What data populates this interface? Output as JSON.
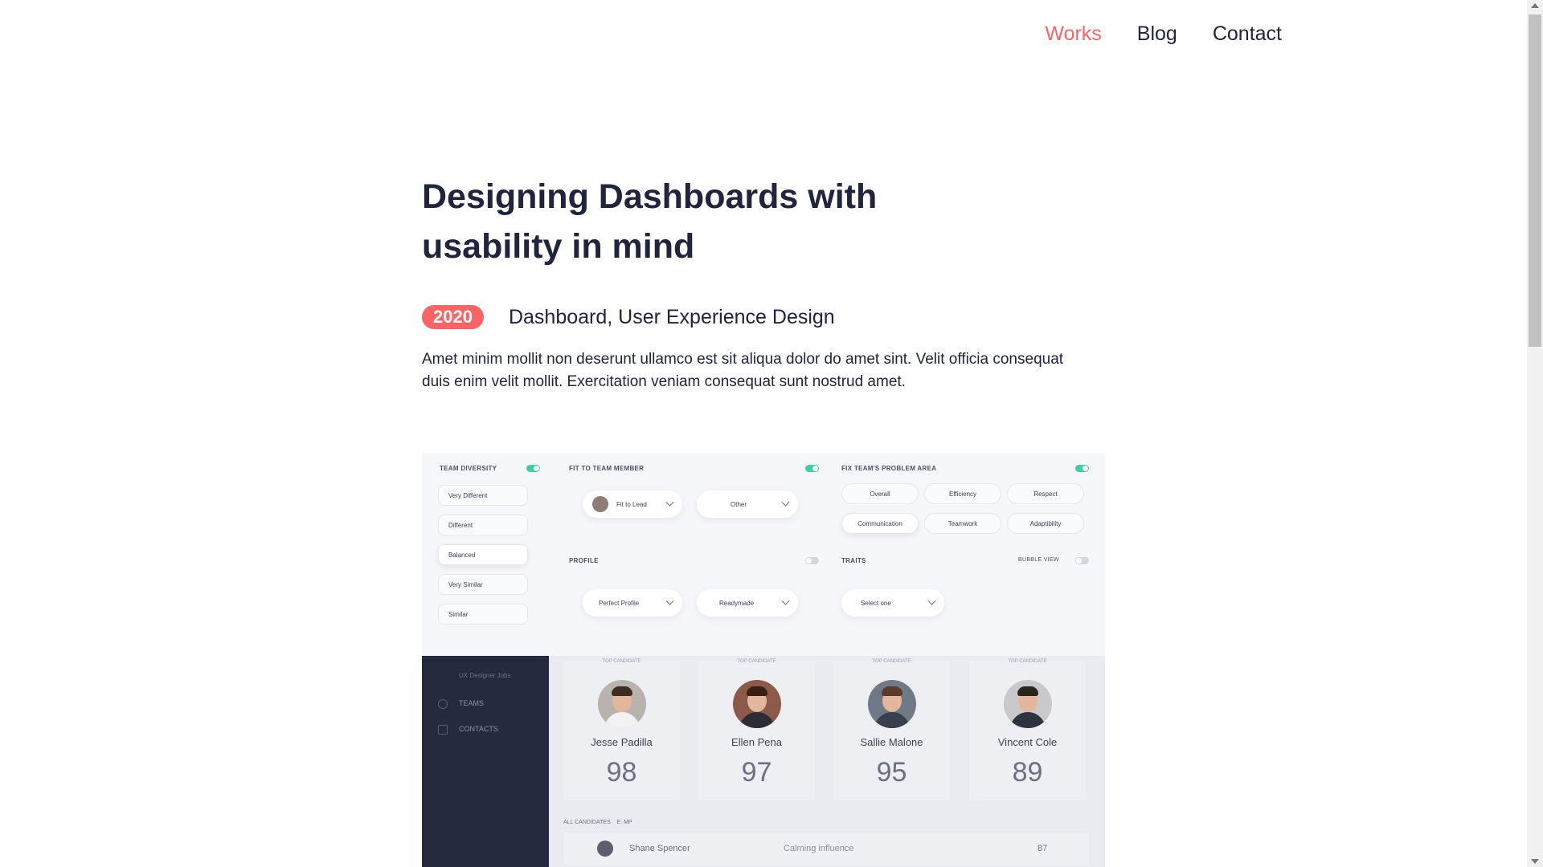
{
  "nav": {
    "items": [
      "Works",
      "Blog",
      "Contact"
    ]
  },
  "article": {
    "title_line1": "Designing Dashboards with",
    "title_line2": "usability in mind",
    "year": "2020",
    "categories": "Dashboard, User Experience Design",
    "description": "Amet minim mollit non deserunt ullamco est sit aliqua dolor do amet sint. Velit officia consequat duis enim velit mollit. Exercitation veniam consequat sunt nostrud amet."
  },
  "dashboard": {
    "team_diversity": {
      "title": "TEAM DIVERSITY",
      "options": [
        "Very Different",
        "Different",
        "Balanced",
        "Very Similar",
        "Similar"
      ]
    },
    "fit_to_team": {
      "title": "FIT TO TEAM MEMBER",
      "dropdown1": "Fit to Lead",
      "dropdown2": "Other"
    },
    "problem_area": {
      "title": "FIX TEAM'S PROBLEM AREA",
      "chips": [
        "Overall",
        "Efficiency",
        "Respect",
        "Communication",
        "Teamwork",
        "Adaptibility"
      ]
    },
    "profile": {
      "title": "PROFILE",
      "dropdown1": "Perfect Profile",
      "dropdown2": "Readymade"
    },
    "traits": {
      "title": "TRAITS",
      "bubble_label": "BUBBLE VIEW",
      "dropdown": "Select one"
    },
    "sidebar": {
      "item_top": "UX Designer Jobs",
      "teams": "TEAMS",
      "contacts": "CONTACTS"
    },
    "candidates": [
      {
        "caption": "TOP CANDIDATE",
        "name": "Jesse Padilla",
        "score": "98"
      },
      {
        "caption": "TOP CANDIDATE",
        "name": "Ellen Pena",
        "score": "97"
      },
      {
        "caption": "TOP CANDIDATE",
        "name": "Sallie Malone",
        "score": "95"
      },
      {
        "caption": "TOP CANDIDATE",
        "name": "Vincent Cole",
        "score": "89"
      }
    ],
    "all_candidates": {
      "label": "ALL CANDIDATES",
      "filter": "E. MP"
    },
    "list_row": {
      "name": "Shane Spencer",
      "trait": "Calming influence",
      "score": "87"
    }
  },
  "colors": {
    "accent": "#ff6464",
    "text": "#21243d",
    "sidebar": "#252a3e",
    "toggle_on": "#3fd0a0"
  }
}
